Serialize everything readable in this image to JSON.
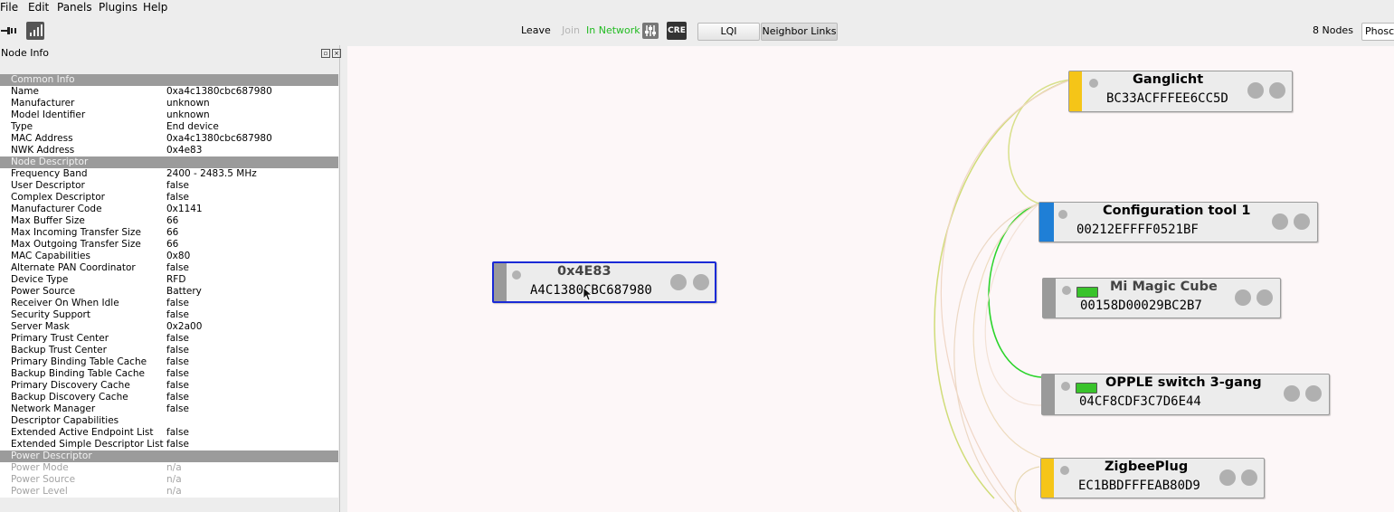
{
  "menu": [
    "File",
    "Edit",
    "Panels",
    "Plugins",
    "Help"
  ],
  "toolbar": {
    "leave": "Leave",
    "join": "Join",
    "network_status": "In Network",
    "cre_label": "CRE",
    "lqi_button": "LQI",
    "neighbor_links_button": "Neighbor Links",
    "node_count": "8 Nodes",
    "gateway_name": "Phosco",
    "status_color": "#22bb22"
  },
  "panel": {
    "title": "Node Info",
    "rows": [
      {
        "type": "section",
        "k": "Common Info"
      },
      {
        "k": "Name",
        "v": "0xa4c1380cbc687980"
      },
      {
        "k": "Manufacturer",
        "v": "unknown"
      },
      {
        "k": "Model Identifier",
        "v": "unknown"
      },
      {
        "k": "Type",
        "v": "End device"
      },
      {
        "k": "MAC Address",
        "v": "0xa4c1380cbc687980"
      },
      {
        "k": "NWK Address",
        "v": "0x4e83"
      },
      {
        "type": "section",
        "k": "Node Descriptor"
      },
      {
        "k": "Frequency Band",
        "v": "2400 - 2483.5 MHz"
      },
      {
        "k": "User Descriptor",
        "v": "false"
      },
      {
        "k": "Complex Descriptor",
        "v": "false"
      },
      {
        "k": "Manufacturer Code",
        "v": "0x1141"
      },
      {
        "k": "Max Buffer Size",
        "v": "66"
      },
      {
        "k": "Max Incoming Transfer Size",
        "v": "66"
      },
      {
        "k": "Max Outgoing Transfer Size",
        "v": "66"
      },
      {
        "k": "MAC Capabilities",
        "v": "0x80"
      },
      {
        "k": "Alternate PAN Coordinator",
        "v": "false"
      },
      {
        "k": "Device Type",
        "v": "RFD"
      },
      {
        "k": "Power Source",
        "v": "Battery"
      },
      {
        "k": "Receiver On When Idle",
        "v": "false"
      },
      {
        "k": "Security Support",
        "v": "false"
      },
      {
        "k": "Server Mask",
        "v": "0x2a00"
      },
      {
        "k": "Primary Trust Center",
        "v": "false"
      },
      {
        "k": "Backup Trust Center",
        "v": "false"
      },
      {
        "k": "Primary Binding Table Cache",
        "v": "false"
      },
      {
        "k": "Backup Binding Table Cache",
        "v": "false"
      },
      {
        "k": "Primary Discovery Cache",
        "v": "false"
      },
      {
        "k": "Backup Discovery Cache",
        "v": "false"
      },
      {
        "k": "Network Manager",
        "v": "false"
      },
      {
        "k": "Descriptor Capabilities",
        "v": ""
      },
      {
        "k": "Extended Active Endpoint List",
        "v": "false"
      },
      {
        "k": "Extended Simple Descriptor List",
        "v": "false"
      },
      {
        "type": "section",
        "k": "Power Descriptor"
      },
      {
        "type": "dim",
        "k": "Power Mode",
        "v": "n/a"
      },
      {
        "type": "dim",
        "k": "Power Source",
        "v": "n/a"
      },
      {
        "type": "dim",
        "k": "Power Level",
        "v": "n/a"
      }
    ]
  },
  "nodes": {
    "selected": {
      "title": "0x4E83",
      "addr": "A4C1380CBC687980",
      "strip_color": "#9a9a9a"
    },
    "ganglicht": {
      "title": "Ganglicht",
      "addr": "BC33ACFFFEE6CC5D",
      "strip_color": "#f5c518"
    },
    "config_tool": {
      "title": "Configuration tool 1",
      "addr": "00212EFFFF0521BF",
      "strip_color": "#1f7fd6"
    },
    "magic_cube": {
      "title": "Mi Magic Cube",
      "addr": "00158D00029BC2B7",
      "strip_color": "#9a9a9a"
    },
    "opple": {
      "title": "OPPLE switch 3-gang",
      "addr": "04CF8CDF3C7D6E44",
      "strip_color": "#9a9a9a"
    },
    "zigbeeplug": {
      "title": "ZigbeePlug",
      "addr": "EC1BBDFFFEAB80D9",
      "strip_color": "#f5c518"
    }
  }
}
